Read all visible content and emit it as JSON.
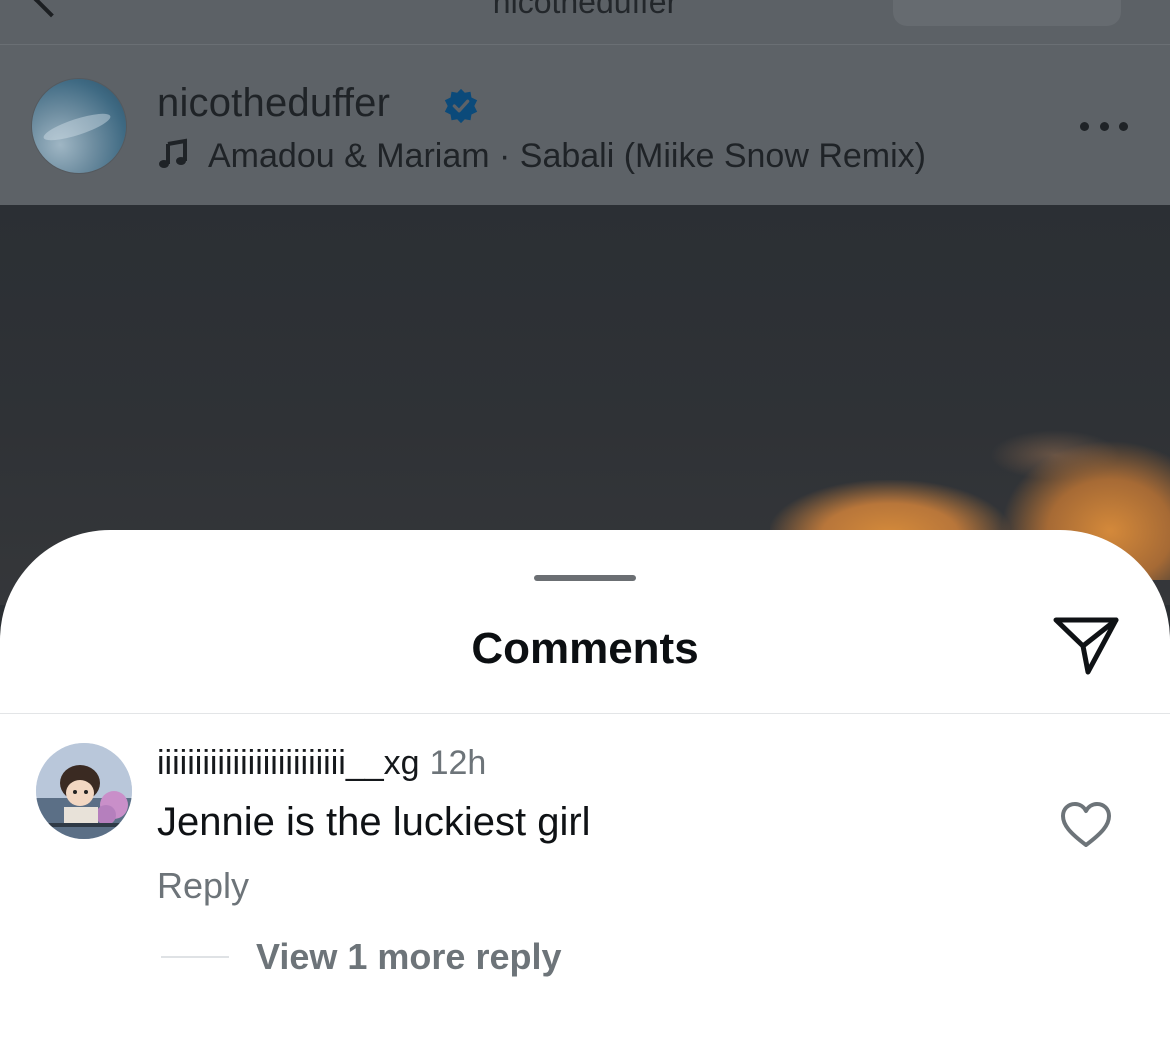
{
  "topnav": {
    "title": "nicotheduffer",
    "back_icon": "chevron-left-icon"
  },
  "post": {
    "username": "nicotheduffer",
    "verified_icon": "verified-badge-icon",
    "verified_color": "#0b4a7a",
    "music_icon": "music-note-icon",
    "music": "Amadou & Mariam · Sabali (Miike Snow Remix)",
    "more_icon": "more-horizontal-icon"
  },
  "sheet": {
    "title": "Comments",
    "share_icon": "send-icon"
  },
  "comment": {
    "username": "iiiiiiiiiiiiiiiiiiiiiiiii__xg",
    "time": "12h",
    "text": "Jennie is the luckiest girl",
    "reply_label": "Reply",
    "like_icon": "heart-icon",
    "view_replies_label": "View 1 more reply"
  },
  "colors": {
    "sheet_bg": "#ffffff",
    "muted_text": "#6d7479",
    "dim_overlay": "#5d6267"
  }
}
